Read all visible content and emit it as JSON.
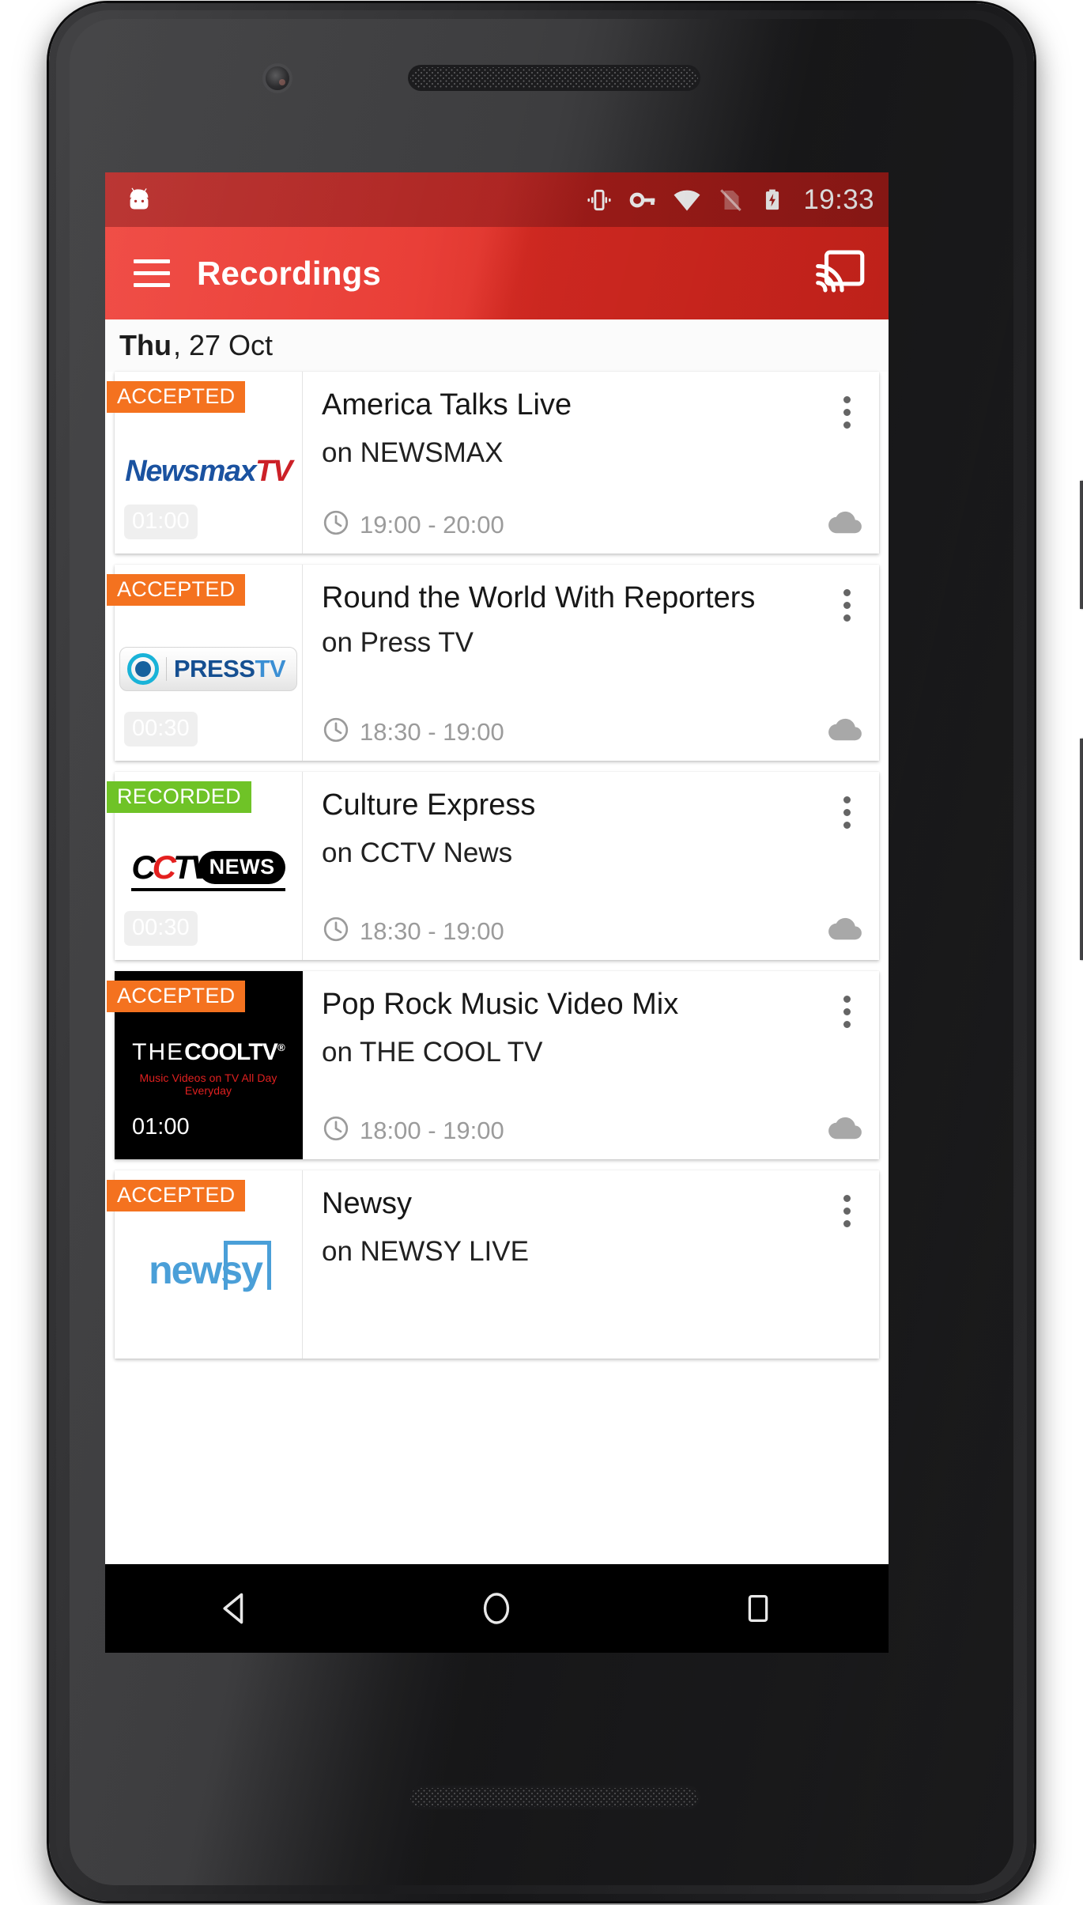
{
  "status_bar": {
    "clock": "19:33",
    "icons": [
      "vibrate-icon",
      "vpn-key-icon",
      "wifi-icon",
      "no-sim-icon",
      "battery-charging-icon"
    ],
    "background_color": "#a91d1a"
  },
  "app_bar": {
    "menu_icon": "hamburger-menu-icon",
    "title": "Recordings",
    "cast_icon": "chromecast-icon",
    "background_color": "#e0302a"
  },
  "date_header": {
    "day_of_week": "Thu",
    "date": ", 27 Oct"
  },
  "status_colors": {
    "accepted": "#f4721f",
    "recorded": "#6fc327"
  },
  "recordings": [
    {
      "status": "ACCEPTED",
      "status_type": "accepted",
      "title": "America Talks Live",
      "channel_line": "on NEWSMAX",
      "time_range": "19:00 - 20:00",
      "duration": "01:00",
      "logo": {
        "name": "newsmax-tv-logo",
        "part1": "Newsmax",
        "part2": "TV"
      },
      "clock_icon": "clock-icon",
      "storage_icon": "cloud-icon",
      "overflow_icon": "more-vertical-icon"
    },
    {
      "status": "ACCEPTED",
      "status_type": "accepted",
      "title": "Round the World With Reporters",
      "channel_line": "on Press TV",
      "time_range": "18:30 - 19:00",
      "duration": "00:30",
      "logo": {
        "name": "press-tv-logo",
        "part1": "PRESS",
        "part2": "TV"
      },
      "clock_icon": "clock-icon",
      "storage_icon": "cloud-icon",
      "overflow_icon": "more-vertical-icon"
    },
    {
      "status": "RECORDED",
      "status_type": "recorded",
      "title": "Culture Express",
      "channel_line": "on CCTV News",
      "time_range": "18:30 - 19:00",
      "duration": "00:30",
      "logo": {
        "name": "cctv-news-logo",
        "part1": "C",
        "part2": "C",
        "part3": "TV",
        "part4": "NEWS"
      },
      "clock_icon": "clock-icon",
      "storage_icon": "cloud-icon",
      "overflow_icon": "more-vertical-icon"
    },
    {
      "status": "ACCEPTED",
      "status_type": "accepted",
      "title": "Pop Rock Music Video Mix",
      "channel_line": "on THE COOL TV",
      "time_range": "18:00 - 19:00",
      "duration": "01:00",
      "logo": {
        "name": "the-cool-tv-logo",
        "part1": "THE",
        "part2": "COOLTV",
        "tagline": "Music Videos on TV All Day Everyday"
      },
      "clock_icon": "clock-icon",
      "storage_icon": "cloud-icon",
      "overflow_icon": "more-vertical-icon"
    },
    {
      "status": "ACCEPTED",
      "status_type": "accepted",
      "title": "Newsy",
      "channel_line": "on NEWSY LIVE",
      "time_range": "",
      "duration": "",
      "logo": {
        "name": "newsy-logo",
        "part1": "newsy"
      },
      "overflow_icon": "more-vertical-icon"
    }
  ],
  "nav_bar": {
    "back_icon": "back-triangle-icon",
    "home_icon": "home-circle-icon",
    "recents_icon": "recents-square-icon"
  }
}
